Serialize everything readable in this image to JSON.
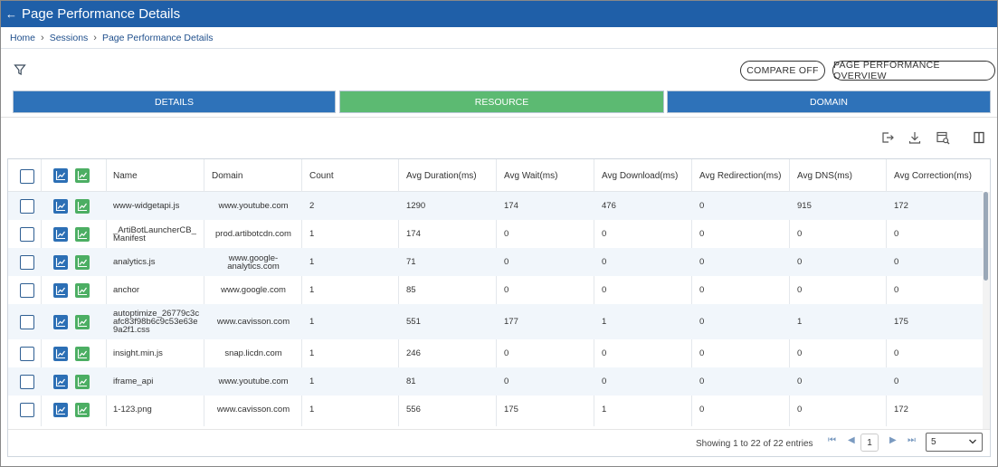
{
  "header": {
    "title": "Page Performance Details",
    "back_icon": "back-arrow-icon"
  },
  "breadcrumb": [
    "Home",
    "Sessions",
    "Page Performance Details"
  ],
  "toolbar": {
    "compare_label": "COMPARE OFF",
    "overview_label": "PAGE PERFORMANCE OVERVIEW"
  },
  "tabs": [
    "DETAILS",
    "RESOURCE",
    "DOMAIN"
  ],
  "colors": {
    "header": "#1f5fa8",
    "tab_blue": "#2e72b9",
    "tab_green": "#5cba72",
    "chart_blue": "#2c6fb5",
    "chart_green": "#4cae63"
  },
  "table": {
    "columns": [
      "Name",
      "Domain",
      "Count",
      "Avg Duration(ms)",
      "Avg Wait(ms)",
      "Avg Download(ms)",
      "Avg Redirection(ms)",
      "Avg DNS(ms)",
      "Avg Correction(ms)"
    ],
    "rows": [
      [
        "www-widgetapi.js",
        "www.youtube.com",
        "2",
        "1290",
        "174",
        "476",
        "0",
        "915",
        "172"
      ],
      [
        "_ArtiBotLauncherCB_\nManifest",
        "prod.artibotcdn.com",
        "1",
        "174",
        "0",
        "0",
        "0",
        "0",
        "0"
      ],
      [
        "analytics.js",
        "www.google-\nanalytics.com",
        "1",
        "71",
        "0",
        "0",
        "0",
        "0",
        "0"
      ],
      [
        "anchor",
        "www.google.com",
        "1",
        "85",
        "0",
        "0",
        "0",
        "0",
        "0"
      ],
      [
        "autoptimize_26779c3c\nafc83f98b6c9c53e63e\n9a2f1.css",
        "www.cavisson.com",
        "1",
        "551",
        "177",
        "1",
        "0",
        "1",
        "175"
      ],
      [
        "insight.min.js",
        "snap.licdn.com",
        "1",
        "246",
        "0",
        "0",
        "0",
        "0",
        "0"
      ],
      [
        "iframe_api",
        "www.youtube.com",
        "1",
        "81",
        "0",
        "0",
        "0",
        "0",
        "0"
      ],
      [
        "1-123.png",
        "www.cavisson.com",
        "1",
        "556",
        "175",
        "1",
        "0",
        "0",
        "172"
      ]
    ]
  },
  "pagination": {
    "showing": "Showing 1 to 22 of 22 entries",
    "page": "1",
    "page_size": "5"
  }
}
